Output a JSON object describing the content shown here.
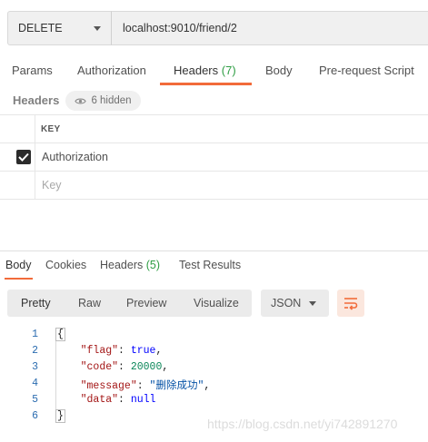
{
  "request": {
    "method": "DELETE",
    "url": "localhost:9010/friend/2"
  },
  "request_tabs": [
    {
      "label": "Params"
    },
    {
      "label": "Authorization"
    },
    {
      "label": "Headers",
      "count": "(7)"
    },
    {
      "label": "Body"
    },
    {
      "label": "Pre-request Script"
    }
  ],
  "headers_section": {
    "title": "Headers",
    "hidden_label": "6 hidden",
    "column_key": "KEY",
    "rows": [
      {
        "key": "Authorization",
        "checked": true
      }
    ],
    "placeholder": "Key"
  },
  "response_tabs": [
    {
      "label": "Body"
    },
    {
      "label": "Cookies"
    },
    {
      "label": "Headers",
      "count": "(5)"
    },
    {
      "label": "Test Results"
    }
  ],
  "view_modes": [
    "Pretty",
    "Raw",
    "Preview",
    "Visualize"
  ],
  "format": "JSON",
  "code": {
    "line_numbers": [
      "1",
      "2",
      "3",
      "4",
      "5",
      "6"
    ],
    "open_brace": "{",
    "close_brace": "}",
    "fields": [
      {
        "key": "\"flag\"",
        "value": "true",
        "type": "bool",
        "comma": ","
      },
      {
        "key": "\"code\"",
        "value": "20000",
        "type": "num",
        "comma": ","
      },
      {
        "key": "\"message\"",
        "value": "\"删除成功\"",
        "type": "str",
        "comma": ","
      },
      {
        "key": "\"data\"",
        "value": "null",
        "type": "bool",
        "comma": ""
      }
    ]
  },
  "watermark": "https://blog.csdn.net/yi742891270",
  "colors": {
    "accent": "#f26b3a",
    "count_green": "#2f9e44"
  },
  "icons": [
    "chevron-down-icon",
    "eye-icon",
    "checkmark-icon",
    "wrap-lines-icon"
  ]
}
